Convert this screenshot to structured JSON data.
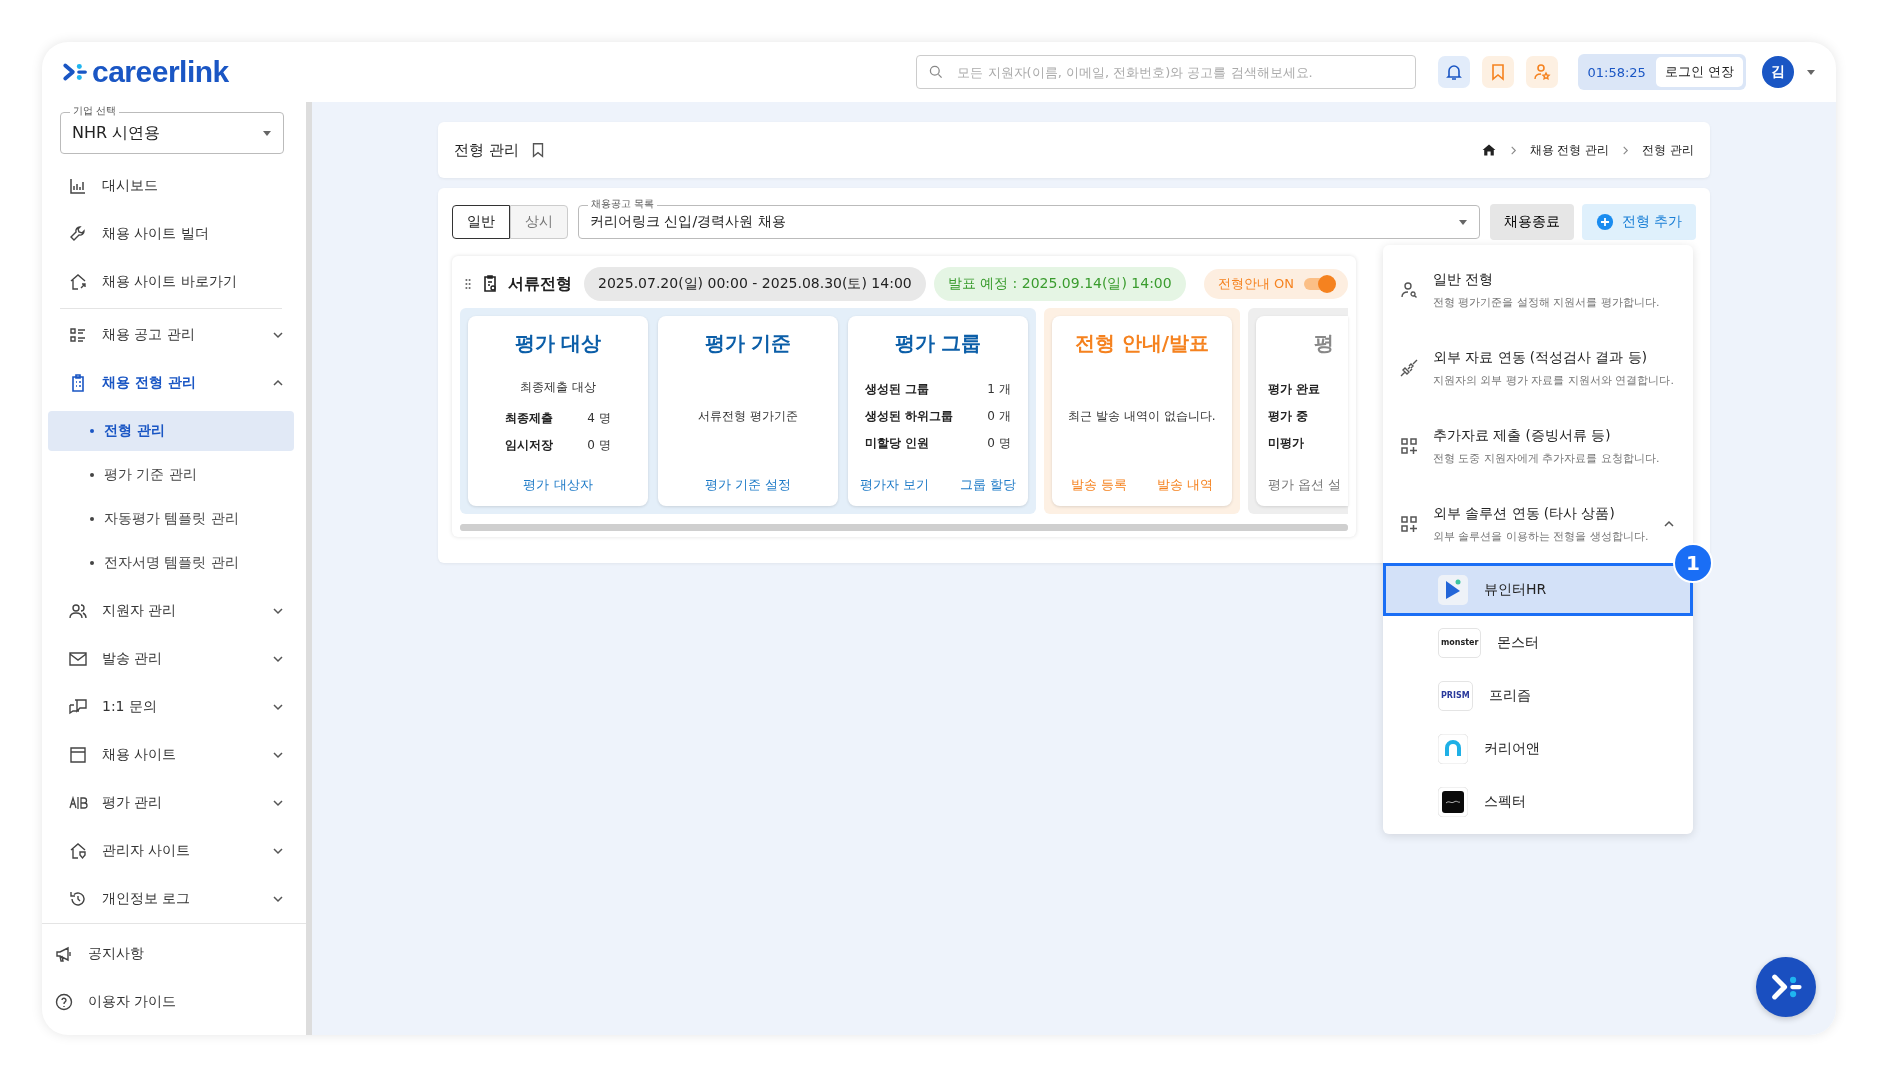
{
  "header": {
    "logo": "careerlink",
    "search": {
      "placeholder": "모든 지원자(이름, 이메일, 전화번호)와 공고를 검색해보세요."
    },
    "timer": "01:58:25",
    "extend_button": "로그인 연장",
    "avatar": "김"
  },
  "sidebar": {
    "company_select": {
      "label": "기업 선택",
      "value": "NHR 시연용"
    },
    "top_items": [
      {
        "label": "대시보드"
      },
      {
        "label": "채용 사이트 빌더"
      },
      {
        "label": "채용 사이트 바로가기"
      }
    ],
    "menu_items": [
      {
        "label": "채용 공고 관리",
        "expanded": false,
        "selected": false
      },
      {
        "label": "채용 전형 관리",
        "expanded": true,
        "selected": true,
        "children": [
          {
            "label": "전형 관리",
            "selected": true
          },
          {
            "label": "평가 기준 관리",
            "selected": false
          },
          {
            "label": "자동평가 템플릿 관리",
            "selected": false
          },
          {
            "label": "전자서명 템플릿 관리",
            "selected": false
          }
        ]
      },
      {
        "label": "지원자 관리",
        "expanded": false,
        "selected": false
      },
      {
        "label": "발송 관리",
        "expanded": false,
        "selected": false
      },
      {
        "label": "1:1 문의",
        "expanded": false,
        "selected": false
      },
      {
        "label": "채용 사이트",
        "expanded": false,
        "selected": false
      },
      {
        "label": "평가 관리",
        "expanded": false,
        "selected": false
      },
      {
        "label": "관리자 사이트",
        "expanded": false,
        "selected": false
      },
      {
        "label": "개인정보 로그",
        "expanded": false,
        "selected": false
      }
    ],
    "bottom_items": [
      {
        "label": "공지사항"
      },
      {
        "label": "이용자 가이드"
      }
    ]
  },
  "page": {
    "title": "전형 관리",
    "breadcrumb": [
      "채용 전형 관리",
      "전형 관리"
    ]
  },
  "toolbar": {
    "tabs": [
      {
        "label": "일반",
        "selected": true
      },
      {
        "label": "상시",
        "selected": false
      }
    ],
    "posting_select": {
      "label": "채용공고 목록",
      "value": "커리어링크 신입/경력사원 채용"
    },
    "end_button": "채용종료",
    "add_button": "전형 추가"
  },
  "stage": {
    "name": "서류전형",
    "period": "2025.07.20(일) 00:00 - 2025.08.30(토) 14:00",
    "announcement": "발표 예정 : 2025.09.14(일) 14:00",
    "toggle": {
      "label": "전형안내 ON",
      "on": true
    },
    "panels": [
      {
        "kind": "evaluation",
        "cards": [
          {
            "title": "평가 대상",
            "subtitle": "최종제출 대상",
            "rows": [
              {
                "label": "최종제출",
                "value": "4 명"
              },
              {
                "label": "임시저장",
                "value": "0 명"
              }
            ],
            "links": [
              "평가 대상자"
            ]
          },
          {
            "title": "평가 기준",
            "note": "서류전형 평가기준",
            "links": [
              "평가 기준 설정"
            ]
          },
          {
            "title": "평가 그룹",
            "rows": [
              {
                "label": "생성된 그룹",
                "value": "1 개"
              },
              {
                "label": "생성된 하위그룹",
                "value": "0 개"
              },
              {
                "label": "미할당 인원",
                "value": "0 명"
              }
            ],
            "links": [
              "평가자 보기",
              "그룹 할당"
            ]
          }
        ]
      },
      {
        "kind": "notice",
        "cards": [
          {
            "title": "전형 안내/발표",
            "note": "최근 발송 내역이 없습니다.",
            "links": [
              "발송 등록",
              "발송 내역"
            ]
          }
        ]
      },
      {
        "kind": "options",
        "cards": [
          {
            "title": "평",
            "rows": [
              {
                "label": "평가 완료"
              },
              {
                "label": "평가 중"
              },
              {
                "label": "미평가"
              }
            ],
            "links": [
              "평가 옵션 설"
            ]
          }
        ]
      }
    ]
  },
  "add_menu": {
    "items": [
      {
        "title": "일반 전형",
        "description": "전형 평가기준을 설정해 지원서를 평가합니다."
      },
      {
        "title": "외부 자료 연동 (적성검사 결과 등)",
        "description": "지원자의 외부 평가 자료를 지원서와 연결합니다."
      },
      {
        "title": "추가자료 제출 (증빙서류 등)",
        "description": "전형 도중 지원자에게 추가자료를 요청합니다."
      },
      {
        "title": "외부 솔루션 연동 (타사 상품)",
        "description": "외부 솔루션을 이용하는 전형을 생성합니다.",
        "expanded": true
      }
    ],
    "solutions": [
      {
        "name": "뷰인터HR",
        "selected": true,
        "badge": "1"
      },
      {
        "name": "몬스터",
        "selected": false,
        "logo_text": "monster"
      },
      {
        "name": "프리즘",
        "selected": false,
        "logo_text": "PRISM"
      },
      {
        "name": "커리어앤",
        "selected": false
      },
      {
        "name": "스펙터",
        "selected": false
      }
    ]
  }
}
